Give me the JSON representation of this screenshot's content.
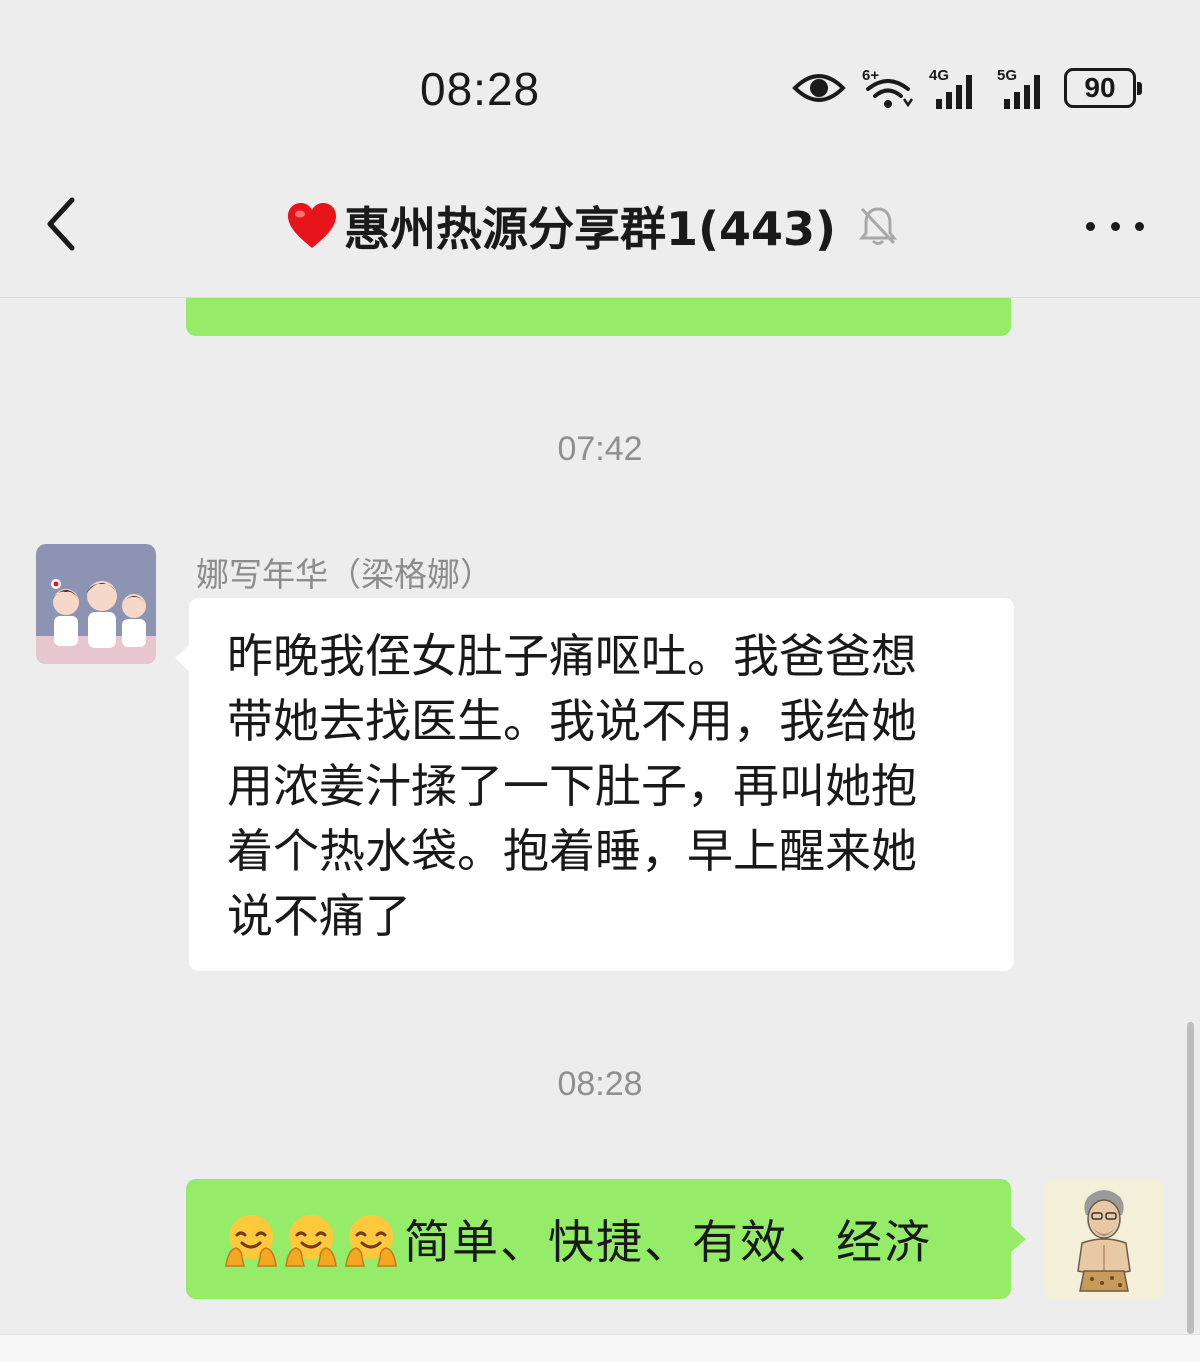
{
  "status_bar": {
    "time": "08:28",
    "battery": "90",
    "icons": [
      "eye-icon",
      "wifi-icon",
      "signal-4g-icon",
      "signal-5g-icon",
      "battery-icon"
    ],
    "network_labels": [
      "6+",
      "4G",
      "5G"
    ]
  },
  "header": {
    "title": "惠州热源分享群1(443)",
    "title_prefix_icon": "red-heart-icon",
    "back_icon": "chevron-left-icon",
    "mute_icon": "bell-muted-icon",
    "more_icon": "more-dots-icon"
  },
  "messages": [
    {
      "type": "partial",
      "side": "outgoing",
      "color": "#95ec69"
    },
    {
      "type": "timestamp",
      "text": "07:42"
    },
    {
      "type": "text",
      "side": "incoming",
      "sender": "娜写年华（梁格娜）",
      "lines": [
        "昨晚我侄女肚子痛呕吐。我爸爸想",
        "带她去找医生。我说不用，我给她",
        "用浓姜汁揉了一下肚子，再叫她抱",
        "着个热水袋。抱着睡，早上醒来她",
        "说不痛了"
      ]
    },
    {
      "type": "timestamp",
      "text": "08:28"
    },
    {
      "type": "text",
      "side": "outgoing",
      "emojis": [
        "hug-face-emoji",
        "hug-face-emoji",
        "hug-face-emoji"
      ],
      "text": "简单、快捷、有效、经济"
    }
  ],
  "colors": {
    "background": "#ededed",
    "outgoing_bubble": "#95ec69",
    "incoming_bubble": "#ffffff",
    "timestamp": "#8f8f8f"
  }
}
